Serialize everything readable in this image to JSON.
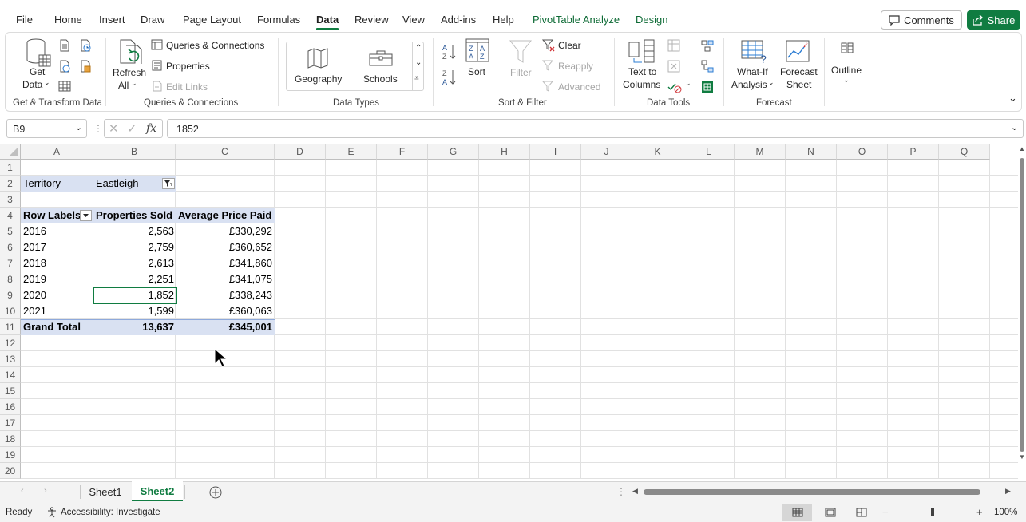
{
  "menu": {
    "items": [
      "File",
      "Home",
      "Insert",
      "Draw",
      "Page Layout",
      "Formulas",
      "Data",
      "Review",
      "View",
      "Add-ins",
      "Help",
      "PivotTable Analyze",
      "Design"
    ],
    "active": "Data",
    "comments_label": "Comments",
    "share_label": "Share"
  },
  "ribbon": {
    "get_data_line1": "Get",
    "get_data_line2": "Data",
    "group_get_transform": "Get & Transform Data",
    "refresh_line1": "Refresh",
    "refresh_line2": "All",
    "queries_connections": "Queries & Connections",
    "properties": "Properties",
    "edit_links": "Edit Links",
    "group_queries": "Queries & Connections",
    "geography": "Geography",
    "schools": "Schools",
    "group_data_types": "Data Types",
    "sort": "Sort",
    "filter": "Filter",
    "clear": "Clear",
    "reapply": "Reapply",
    "advanced": "Advanced",
    "group_sort_filter": "Sort & Filter",
    "text_to_columns_line1": "Text to",
    "text_to_columns_line2": "Columns",
    "group_data_tools": "Data Tools",
    "what_if_line1": "What-If",
    "what_if_line2": "Analysis",
    "forecast_sheet_line1": "Forecast",
    "forecast_sheet_line2": "Sheet",
    "group_forecast": "Forecast",
    "outline": "Outline"
  },
  "formula_bar": {
    "name_box": "B9",
    "fx": "fx",
    "value": "1852"
  },
  "grid": {
    "columns": [
      "A",
      "B",
      "C",
      "D",
      "E",
      "F",
      "G",
      "H",
      "I",
      "J",
      "K",
      "L",
      "M",
      "N",
      "O",
      "P",
      "Q"
    ],
    "rows": [
      "1",
      "2",
      "3",
      "4",
      "5",
      "6",
      "7",
      "8",
      "9",
      "10",
      "11",
      "12",
      "13",
      "14",
      "15",
      "16",
      "17",
      "18",
      "19",
      "20"
    ]
  },
  "pivot": {
    "filter_label": "Territory",
    "filter_value": "Eastleigh",
    "headers": [
      "Row Labels",
      "Properties Sold",
      "Average Price Paid"
    ],
    "rows": [
      [
        "2016",
        "2,563",
        "£330,292"
      ],
      [
        "2017",
        "2,759",
        "£360,652"
      ],
      [
        "2018",
        "2,613",
        "£341,860"
      ],
      [
        "2019",
        "2,251",
        "£341,075"
      ],
      [
        "2020",
        "1,852",
        "£338,243"
      ],
      [
        "2021",
        "1,599",
        "£360,063"
      ]
    ],
    "total": [
      "Grand Total",
      "13,637",
      "£345,001"
    ]
  },
  "sheets": {
    "tabs": [
      "Sheet1",
      "Sheet2"
    ],
    "active": "Sheet2"
  },
  "status": {
    "ready": "Ready",
    "accessibility": "Accessibility: Investigate",
    "zoom": "100%"
  },
  "colors": {
    "accent": "#107c41",
    "pivot_band": "#d9e1f2"
  }
}
